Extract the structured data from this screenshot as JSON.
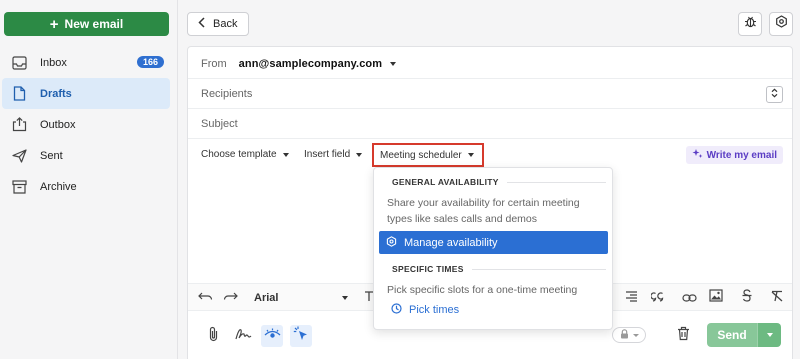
{
  "sidebar": {
    "new_email_label": "New email",
    "items": [
      {
        "label": "Inbox",
        "badge": "166"
      },
      {
        "label": "Drafts"
      },
      {
        "label": "Outbox"
      },
      {
        "label": "Sent"
      },
      {
        "label": "Archive"
      }
    ],
    "active_item": "Drafts"
  },
  "topbar": {
    "back_label": "Back"
  },
  "composer": {
    "from_label": "From",
    "from_value": "ann@samplecompany.com",
    "recipients_placeholder": "Recipients",
    "subject_placeholder": "Subject",
    "tools": {
      "choose_template": "Choose template",
      "insert_field": "Insert field",
      "meeting_scheduler": "Meeting scheduler",
      "write_my_email": "Write my email"
    },
    "format": {
      "font": "Arial"
    },
    "send_label": "Send"
  },
  "meeting_popover": {
    "general_header": "GENERAL AVAILABILITY",
    "general_desc": "Share your availability for certain meeting types like sales calls and demos",
    "manage_label": "Manage availability",
    "specific_header": "SPECIFIC TIMES",
    "specific_desc": "Pick specific slots for a one-time meeting",
    "pick_label": "Pick times"
  },
  "colors": {
    "primary_green": "#2c8a45",
    "accent_blue": "#2b6fd3",
    "highlight_red": "#d63a2c",
    "send_green": "#88c799"
  }
}
